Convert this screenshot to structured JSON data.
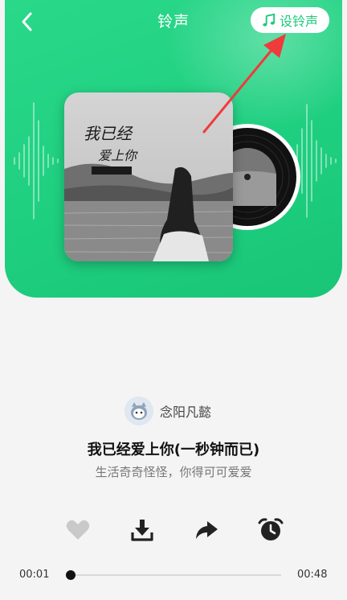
{
  "header": {
    "title": "铃声",
    "set_ringtone_label": "设铃声"
  },
  "song": {
    "artist": "念阳凡懿",
    "title": "我已经爱上你(一秒钟而已)",
    "subtitle": "生活奇奇怪怪，你得可可爱爱"
  },
  "cover_text": {
    "line1": "我已经",
    "line2": "爱上你"
  },
  "actions": [
    "heart-icon",
    "download-icon",
    "share-icon",
    "alarm-clock-icon"
  ],
  "player": {
    "current_time": "00:01",
    "total_time": "00:48",
    "progress": 0.0
  },
  "colors": {
    "accent": "#1fcf80",
    "background": "#f4f4f4",
    "arrow": "#ef3b3b"
  }
}
